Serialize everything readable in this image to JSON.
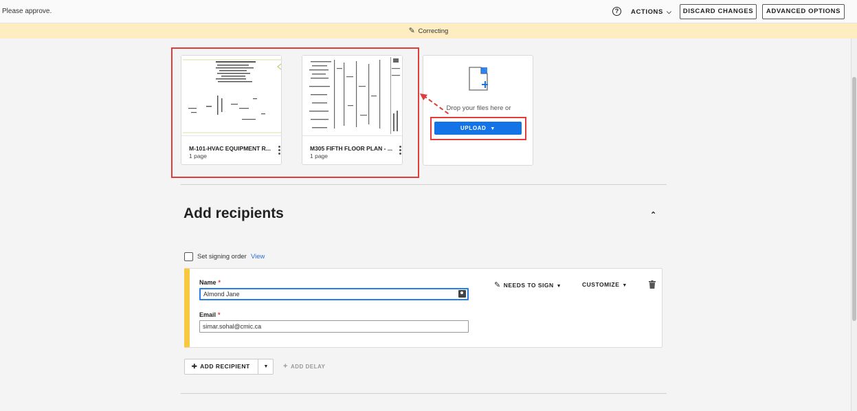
{
  "topbar": {
    "message": "Please approve.",
    "help_icon": "?",
    "actions_label": "ACTIONS",
    "discard_label": "DISCARD CHANGES",
    "advanced_label": "ADVANCED OPTIONS"
  },
  "banner": {
    "text": "Correcting"
  },
  "files": [
    {
      "name": "M-101-HVAC EQUIPMENT R...",
      "pages": "1 page"
    },
    {
      "name": "M305 FIFTH FLOOR PLAN - ...",
      "pages": "1 page"
    }
  ],
  "upload": {
    "drop_text": "Drop your files here or",
    "button_label": "UPLOAD"
  },
  "recipients": {
    "title": "Add recipients",
    "signing_order_label": "Set signing order",
    "view_link": "View",
    "items": [
      {
        "name_label": "Name",
        "name_value": "Almond Jane",
        "email_label": "Email",
        "email_value": "simar.sohal@cmic.ca",
        "role_label": "NEEDS TO SIGN",
        "customize_label": "CUSTOMIZE"
      }
    ],
    "add_recipient_label": "ADD RECIPIENT",
    "add_delay_label": "ADD DELAY"
  },
  "colors": {
    "accent_blue": "#1473e6",
    "highlight_red": "#e03c3c",
    "banner_yellow": "#fdedc1",
    "recipient_stripe": "#f8c940"
  }
}
